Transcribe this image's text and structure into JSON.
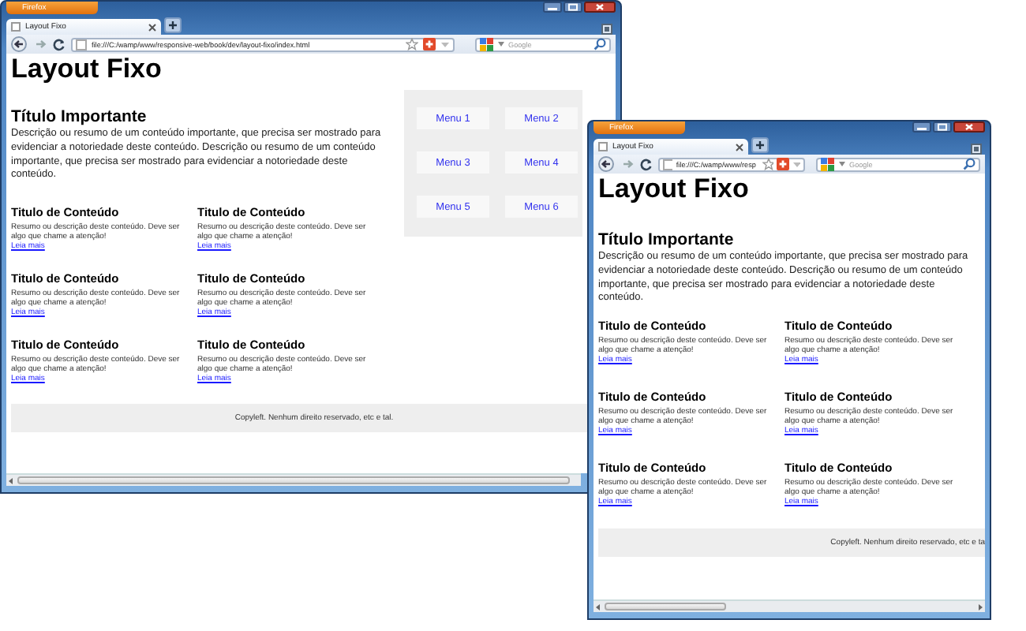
{
  "windows": [
    {
      "app_button": "Firefox",
      "tab_title": "Layout Fixo",
      "url": "file:///C:/wamp/www/responsive-web/book/dev/layout-fixo/index.html",
      "search": {
        "placeholder": "Google"
      },
      "page": {
        "title": "Layout Fixo",
        "lead_title": "Título Importante",
        "lead_text": "Descrição ou resumo de um conteúdo importante, que precisa ser mostrado para evidenciar a notoriedade deste conteúdo. Descrição ou resumo de um conteúdo importante, que precisa ser mostrado para evidenciar a notoriedade deste conteúdo.",
        "menu": [
          {
            "label": "Menu 1"
          },
          {
            "label": "Menu 2"
          },
          {
            "label": "Menu 3"
          },
          {
            "label": "Menu 4"
          },
          {
            "label": "Menu 5"
          },
          {
            "label": "Menu 6"
          }
        ],
        "cards": [
          {
            "title": "Titulo de Conteúdo",
            "summary": "Resumo ou descrição deste conteúdo. Deve ser algo que chame a atenção!",
            "link": "Leia mais"
          },
          {
            "title": "Titulo de Conteúdo",
            "summary": "Resumo ou descrição deste conteúdo. Deve ser algo que chame a atenção!",
            "link": "Leia mais"
          },
          {
            "title": "Titulo de Conteúdo",
            "summary": "Resumo ou descrição deste conteúdo. Deve ser algo que chame a atenção!",
            "link": "Leia mais"
          },
          {
            "title": "Titulo de Conteúdo",
            "summary": "Resumo ou descrição deste conteúdo. Deve ser algo que chame a atenção!",
            "link": "Leia mais"
          },
          {
            "title": "Titulo de Conteúdo",
            "summary": "Resumo ou descrição deste conteúdo. Deve ser algo que chame a atenção!",
            "link": "Leia mais"
          },
          {
            "title": "Titulo de Conteúdo",
            "summary": "Resumo ou descrição deste conteúdo. Deve ser algo que chame a atenção!",
            "link": "Leia mais"
          }
        ],
        "footer": "Copyleft. Nenhum direito reservado, etc e tal."
      }
    },
    {
      "app_button": "Firefox",
      "tab_title": "Layout Fixo",
      "url": "file:///C:/wamp/www/resp",
      "search": {
        "placeholder": "Google"
      },
      "page": {
        "title": "Layout Fixo",
        "lead_title": "Título Importante",
        "lead_text": "Descrição ou resumo de um conteúdo importante, que precisa ser mostrado para evidenciar a notoriedade deste conteúdo. Descrição ou resumo de um conteúdo importante, que precisa ser mostrado para evidenciar a notoriedade deste conteúdo.",
        "cards": [
          {
            "title": "Titulo de Conteúdo",
            "summary": "Resumo ou descrição deste conteúdo. Deve ser algo que chame a atenção!",
            "link": "Leia mais"
          },
          {
            "title": "Titulo de Conteúdo",
            "summary": "Resumo ou descrição deste conteúdo. Deve ser algo que chame a atenção!",
            "link": "Leia mais"
          },
          {
            "title": "Titulo de Conteúdo",
            "summary": "Resumo ou descrição deste conteúdo. Deve ser algo que chame a atenção!",
            "link": "Leia mais"
          },
          {
            "title": "Titulo de Conteúdo",
            "summary": "Resumo ou descrição deste conteúdo. Deve ser algo que chame a atenção!",
            "link": "Leia mais"
          },
          {
            "title": "Titulo de Conteúdo",
            "summary": "Resumo ou descrição deste conteúdo. Deve ser algo que chame a atenção!",
            "link": "Leia mais"
          },
          {
            "title": "Titulo de Conteúdo",
            "summary": "Resumo ou descrição deste conteúdo. Deve ser algo que chame a atenção!",
            "link": "Leia mais"
          }
        ],
        "footer": "Copyleft. Nenhum direito reservado, etc e ta"
      }
    }
  ]
}
